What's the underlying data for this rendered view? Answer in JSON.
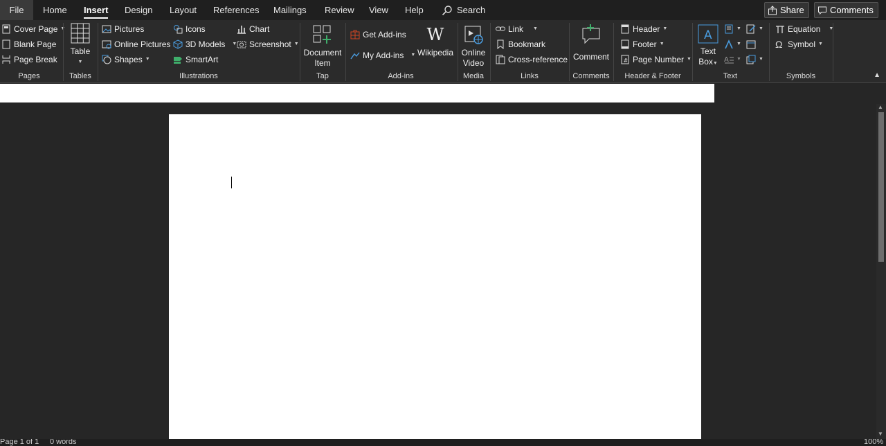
{
  "tabs": [
    {
      "label": "File"
    },
    {
      "label": "Home"
    },
    {
      "label": "Insert",
      "active": true
    },
    {
      "label": "Design"
    },
    {
      "label": "Layout"
    },
    {
      "label": "References"
    },
    {
      "label": "Mailings"
    },
    {
      "label": "Review"
    },
    {
      "label": "View"
    },
    {
      "label": "Help"
    }
  ],
  "search_label": "Search",
  "share_label": "Share",
  "comments_label": "Comments",
  "groups": {
    "pages": {
      "label": "Pages",
      "items": [
        "Cover Page",
        "Blank Page",
        "Page Break"
      ]
    },
    "tables": {
      "label": "Tables",
      "table": "Table"
    },
    "illustrations": {
      "label": "Illustrations",
      "items": [
        "Pictures",
        "Online Pictures",
        "Shapes",
        "Icons",
        "3D Models",
        "SmartArt",
        "Chart",
        "Screenshot"
      ]
    },
    "tap": {
      "label": "Tap",
      "doc_item_1": "Document",
      "doc_item_2": "Item"
    },
    "addins": {
      "label": "Add-ins",
      "get": "Get Add-ins",
      "my": "My Add-ins",
      "wiki": "Wikipedia"
    },
    "media": {
      "label": "Media",
      "video_1": "Online",
      "video_2": "Video"
    },
    "links": {
      "label": "Links",
      "items": [
        "Link",
        "Bookmark",
        "Cross-reference"
      ]
    },
    "comments": {
      "label": "Comments",
      "comment": "Comment"
    },
    "header_footer": {
      "label": "Header & Footer",
      "items": [
        "Header",
        "Footer",
        "Page Number"
      ]
    },
    "text": {
      "label": "Text",
      "textbox_1": "Text",
      "textbox_2": "Box"
    },
    "symbols": {
      "label": "Symbols",
      "items": [
        "Equation",
        "Symbol"
      ]
    }
  },
  "status": {
    "page": "Page 1 of 1",
    "words": "0 words",
    "zoom": "100%"
  },
  "colors": {
    "accent_red": "#d04423",
    "accent_green": "#3fae6b",
    "accent_blue": "#4a9de0"
  }
}
